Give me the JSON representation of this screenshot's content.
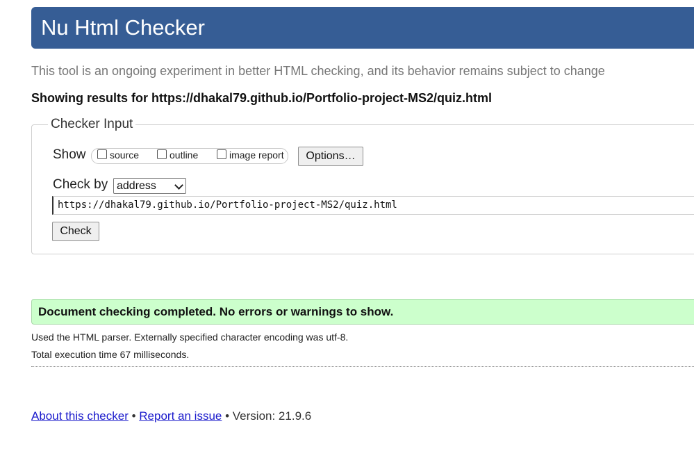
{
  "header": {
    "title": "Nu Html Checker"
  },
  "tagline": "This tool is an ongoing experiment in better HTML checking, and its behavior remains subject to change",
  "results_heading": "Showing results for https://dhakal79.github.io/Portfolio-project-MS2/quiz.html",
  "checker_input": {
    "legend": "Checker Input",
    "show_label": "Show",
    "options": [
      {
        "label": "source",
        "checked": false
      },
      {
        "label": "outline",
        "checked": false
      },
      {
        "label": "image report",
        "checked": false
      }
    ],
    "options_button": "Options…",
    "check_by_label": "Check by",
    "check_by_selected": "address",
    "url_value": "https://dhakal79.github.io/Portfolio-project-MS2/quiz.html",
    "check_button": "Check"
  },
  "result": {
    "success_message": "Document checking completed. No errors or warnings to show.",
    "parser_info": "Used the HTML parser. Externally specified character encoding was utf-8.",
    "execution_time": "Total execution time 67 milliseconds."
  },
  "footer": {
    "about_link": "About this checker",
    "separator": "•",
    "report_link": "Report an issue",
    "version": "Version: 21.9.6"
  },
  "colors": {
    "header_bg": "#365d95",
    "success_bg": "#ccffcc",
    "link": "#1a1acc"
  }
}
